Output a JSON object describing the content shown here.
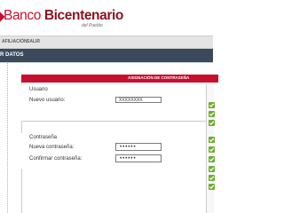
{
  "header": {
    "brand_light": "Banco ",
    "brand_bold": "Bicentenario",
    "brand_sub": "del Pueblo"
  },
  "nav": {
    "items": [
      "AFILIACIÓN",
      "SALIR"
    ]
  },
  "page": {
    "title": "R DATOS"
  },
  "panel": {
    "title": "ASIGNACIÓN DE CONTRASEÑA",
    "usuario": {
      "section_title": "Usuario",
      "field_label": "Nuevo usuario:",
      "field_value": "XXXXXXXX"
    },
    "contrasena": {
      "section_title": "Contraseña",
      "new_label": "Nueva contraseña:",
      "new_value": "••••••",
      "confirm_label": "Confirmar contraseña:",
      "confirm_value": "••••••"
    }
  },
  "colors": {
    "brand_red": "#c8102e",
    "title_bar": "#3a4a5c",
    "check_green": "#6fae2f"
  },
  "icons": {
    "status": "checkmark-icon"
  }
}
